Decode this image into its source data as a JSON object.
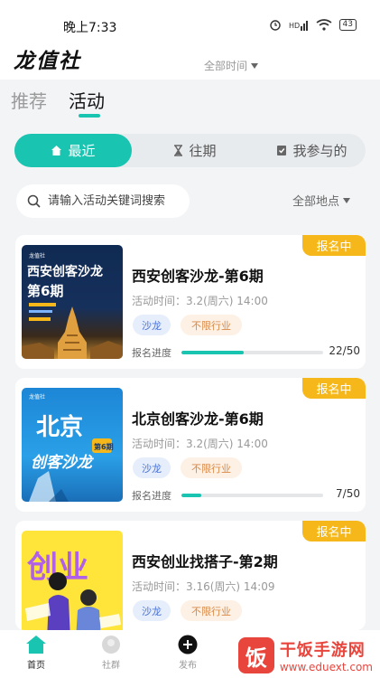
{
  "status_bar": {
    "time": "晚上7:33",
    "battery": "43"
  },
  "app": {
    "logo": "龙值社"
  },
  "top_tabs": [
    {
      "label": "推荐"
    },
    {
      "label": "活动"
    }
  ],
  "segments": [
    {
      "label": "最近"
    },
    {
      "label": "往期"
    },
    {
      "label": "我参与的"
    }
  ],
  "search": {
    "placeholder": "请输入活动关键词搜索"
  },
  "filters": {
    "time": "全部时间",
    "location": "全部地点"
  },
  "events": [
    {
      "badge": "报名中",
      "title": "西安创客沙龙-第6期",
      "time": "活动时间：3.2(周六) 14:00",
      "tag_category": "沙龙",
      "tag_industry": "不限行业",
      "progress_label": "报名进度",
      "count": "22/50",
      "progress": 0.44,
      "poster_brand": "龙值社",
      "poster_line1": "西安创客沙龙",
      "poster_line2": "第6期"
    },
    {
      "badge": "报名中",
      "title": "北京创客沙龙-第6期",
      "time": "活动时间：3.2(周六) 14:00",
      "tag_category": "沙龙",
      "tag_industry": "不限行业",
      "progress_label": "报名进度",
      "count": "7/50",
      "progress": 0.14,
      "poster_brand": "龙值社",
      "poster_line1": "北京",
      "poster_line2": "创客沙龙",
      "poster_badge": "第6期"
    },
    {
      "badge": "报名中",
      "title": "西安创业找搭子-第2期",
      "time": "活动时间：3.16(周六) 14:09",
      "tag_category": "沙龙",
      "tag_industry": "不限行业",
      "poster_line1": "创业"
    }
  ],
  "tab_bar": [
    {
      "label": "首页"
    },
    {
      "label": "社群"
    },
    {
      "label": "发布"
    }
  ],
  "watermark": {
    "logo": "饭",
    "name": "干饭手游网",
    "url": "www.eduext.com"
  },
  "colors": {
    "accent": "#19c4b0",
    "badge": "#f5b71a",
    "tag_category_bg": "#e6eefc",
    "tag_industry_bg": "#fdf0e4"
  }
}
